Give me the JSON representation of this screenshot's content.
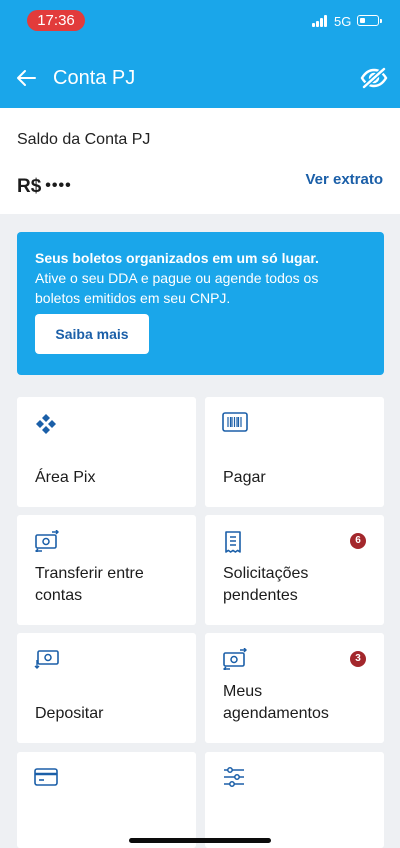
{
  "status_bar": {
    "time": "17:36",
    "network": "5G"
  },
  "header": {
    "title": "Conta PJ"
  },
  "balance": {
    "title": "Saldo da Conta PJ",
    "currency": "R$",
    "masked_value": "••••",
    "statement_link": "Ver extrato"
  },
  "promo": {
    "title": "Seus boletos organizados em um só lugar.",
    "text": "Ative o seu DDA e pague ou agende todos os boletos emitidos em seu CNPJ.",
    "button_label": "Saiba mais"
  },
  "tiles": [
    {
      "label": "Área Pix",
      "icon": "pix-icon"
    },
    {
      "label": "Pagar",
      "icon": "barcode-icon"
    },
    {
      "label": "Transferir entre contas",
      "icon": "transfer-icon"
    },
    {
      "label": "Solicitações pendentes",
      "icon": "receipt-icon",
      "badge": "6"
    },
    {
      "label": "Depositar",
      "icon": "deposit-icon"
    },
    {
      "label": "Meus agendamentos",
      "icon": "scheduled-icon",
      "badge": "3"
    },
    {
      "label": "",
      "icon": "card-icon"
    },
    {
      "label": "",
      "icon": "settings-sliders-icon"
    }
  ],
  "colors": {
    "brand_blue": "#1aa6ea",
    "link_blue": "#1b5fa8",
    "badge_red": "#a3272c"
  }
}
